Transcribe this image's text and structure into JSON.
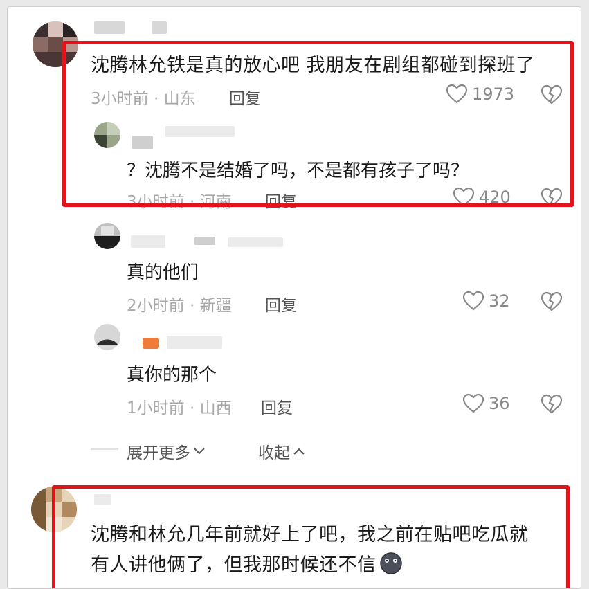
{
  "comments": [
    {
      "text": "沈腾林允铁是真的放心吧 我朋友在剧组都碰到探班了",
      "time_location": "3小时前 · 山东",
      "reply_label": "回复",
      "likes": "1973"
    },
    {
      "text_line1": "沈腾和林允几年前就好上了吧，我之前在贴吧吃瓜就",
      "text_line2": "有人讲他俩了，但我那时候还不信"
    }
  ],
  "replies": [
    {
      "text": "？沈腾不是结婚了吗，不是都有孩子了吗？",
      "time_location": "3小时前 · 河南",
      "reply_label": "回复",
      "likes": "420"
    },
    {
      "text": "真的他们",
      "time_location": "2小时前 · 新疆",
      "reply_label": "回复",
      "likes": "32"
    },
    {
      "text": "真你的那个",
      "time_location": "1小时前 · 山西",
      "reply_label": "回复",
      "likes": "36"
    }
  ],
  "thread_controls": {
    "expand_more": "展开更多",
    "collapse": "收起"
  },
  "colors": {
    "highlight_border": "#e3121b",
    "text": "#1a1a1a",
    "meta": "#a8a8a8"
  }
}
